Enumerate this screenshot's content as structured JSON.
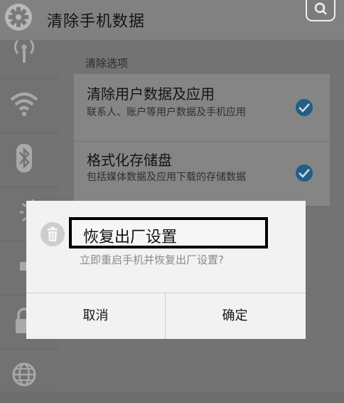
{
  "header": {
    "title": "清除手机数据",
    "settings_icon": "gear-icon",
    "corner_icon": "search-icon"
  },
  "sidebar": {
    "icons": [
      "antenna-icon",
      "wifi-icon",
      "bluetooth-icon",
      "brightness-icon",
      "volume-icon",
      "lock-icon",
      "globe-icon"
    ]
  },
  "main": {
    "section_title": "清除选项",
    "options": [
      {
        "title": "清除用户数据及应用",
        "description": "联系人、账户等用户数据及手机应用",
        "checked": true
      },
      {
        "title": "格式化存储盘",
        "description": "包括媒体数据及应用下载的存储数据",
        "checked": true
      }
    ]
  },
  "dialog": {
    "icon": "trash-icon",
    "title": "恢复出厂设置",
    "message": "立即重启手机并恢复出厂设置?",
    "cancel_label": "取消",
    "confirm_label": "确定"
  },
  "colors": {
    "check_accent": "#1f5f88",
    "dialog_bg": "#f2f2f2"
  }
}
